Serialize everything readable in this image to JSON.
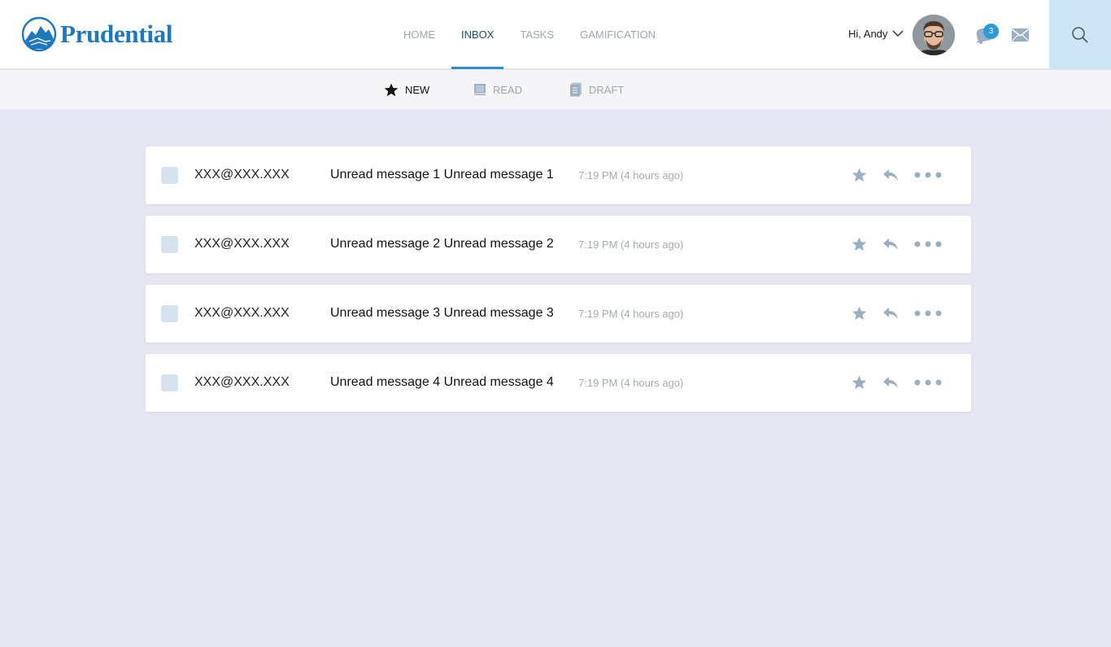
{
  "brand": {
    "name": "Prudential",
    "color": "#1e78be"
  },
  "nav": {
    "items": [
      {
        "label": "HOME",
        "active": false
      },
      {
        "label": "INBOX",
        "active": true
      },
      {
        "label": "TASKS",
        "active": false
      },
      {
        "label": "GAMIFICATION",
        "active": false
      }
    ]
  },
  "user": {
    "greeting": "Hi, Andy",
    "avatar_icon": "user-avatar"
  },
  "notifications": {
    "count": "3",
    "icon": "bell-icon"
  },
  "mail_icon": "envelope-icon",
  "search_icon": "search-icon",
  "subnav": {
    "items": [
      {
        "label": "NEW",
        "icon": "star-icon",
        "active": true
      },
      {
        "label": "READ",
        "icon": "book-icon",
        "active": false
      },
      {
        "label": "DRAFT",
        "icon": "draft-icon",
        "active": false
      }
    ]
  },
  "messages": [
    {
      "from": "XXX@XXX.XXX",
      "subject": "Unread message 1 Unread message 1",
      "time": "7:19 PM (4 hours ago)"
    },
    {
      "from": "XXX@XXX.XXX",
      "subject": "Unread message 2 Unread message 2",
      "time": "7:19 PM (4 hours ago)"
    },
    {
      "from": "XXX@XXX.XXX",
      "subject": "Unread message 3 Unread message 3",
      "time": "7:19 PM (4 hours ago)"
    },
    {
      "from": "XXX@XXX.XXX",
      "subject": "Unread message 4 Unread message 4",
      "time": "7:19 PM (4 hours ago)"
    }
  ],
  "colors": {
    "accent": "#2a8fd0",
    "icon_grey": "#9aafc2",
    "background": "#e5e6ef"
  }
}
